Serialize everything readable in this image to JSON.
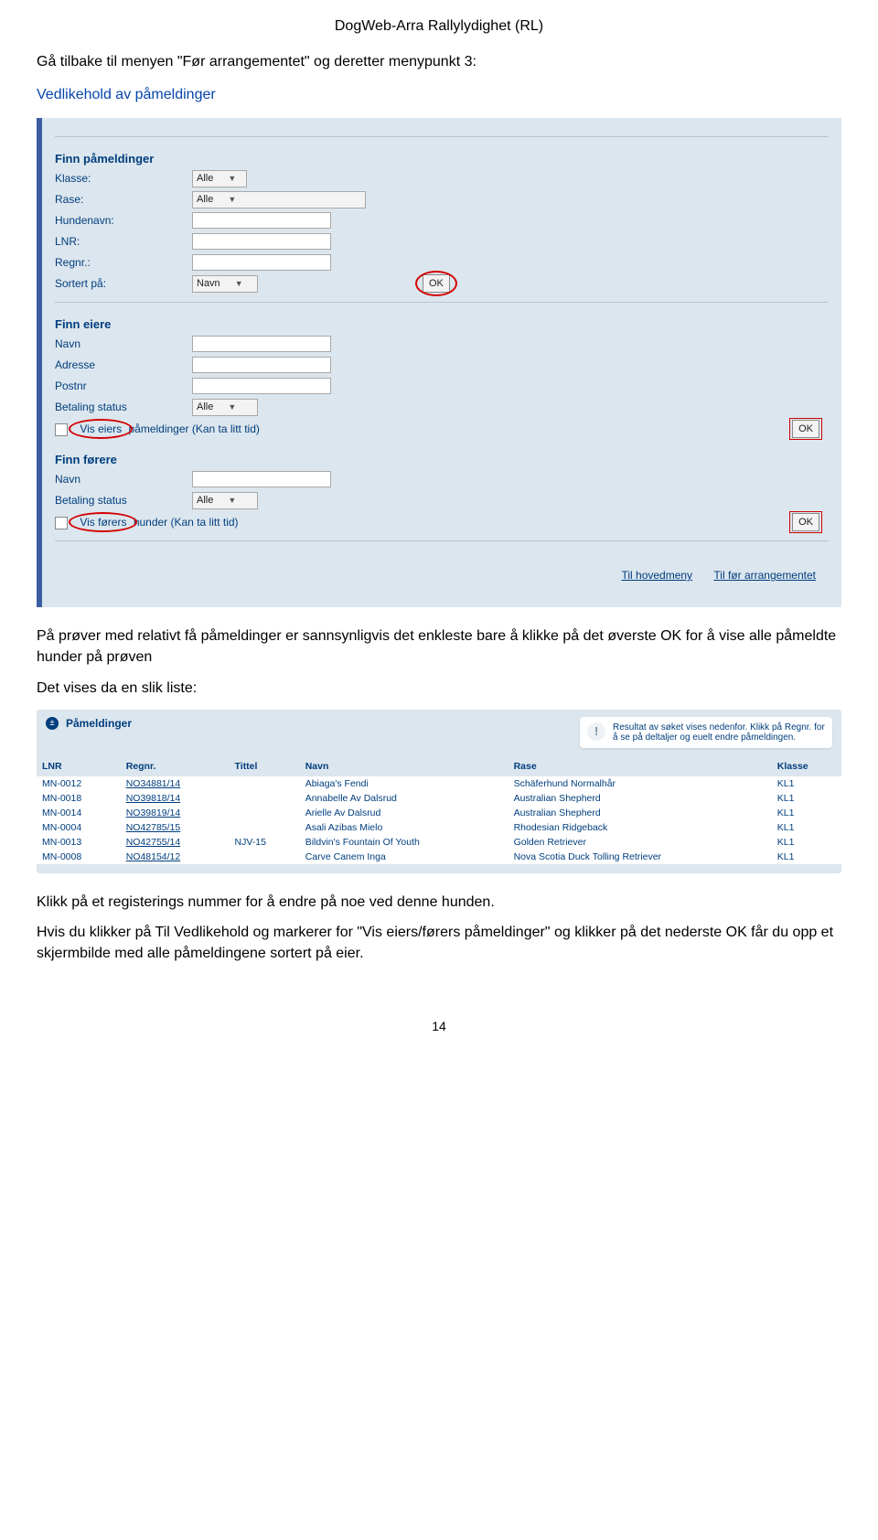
{
  "header": "DogWeb-Arra Rallylydighet (RL)",
  "intro1": "Gå tilbake til menyen \"Før arrangementet\" og deretter menypunkt 3:",
  "intro2": "Vedlikehold av påmeldinger",
  "ss1": {
    "finn_pameldinger": "Finn påmeldinger",
    "klasse": "Klasse:",
    "rase": "Rase:",
    "hundenavn": "Hundenavn:",
    "lnr": "LNR:",
    "regnr": "Regnr.:",
    "sortert": "Sortert på:",
    "alle": "Alle",
    "navn": "Navn",
    "ok": "OK",
    "finn_eiere": "Finn eiere",
    "e_navn": "Navn",
    "e_adresse": "Adresse",
    "e_postnr": "Postnr",
    "betaling": "Betaling status",
    "vis_eiers": "Vis eiers påmeldinger (Kan ta litt tid)",
    "finn_forere": "Finn førere",
    "vis_forers": "Vis førers hunder (Kan ta litt tid)",
    "hovedmeny": "Til hovedmeny",
    "for_arr": "Til før arrangementet"
  },
  "mid1": "På prøver med relativt få påmeldinger er sannsynligvis det enkleste bare å klikke på det øverste OK for å vise alle påmeldte hunder på prøven",
  "mid2": "Det vises da en slik liste:",
  "ss2": {
    "pameldinger": "Påmeldinger",
    "info": "Resultat av søket vises nedenfor. Klikk på Regnr. for å se på deltaljer og euelt endre påmeldingen.",
    "headers": {
      "lnr": "LNR",
      "regnr": "Regnr.",
      "tittel": "Tittel",
      "navn": "Navn",
      "rase": "Rase",
      "klasse": "Klasse"
    },
    "rows": [
      {
        "lnr": "MN-0012",
        "regnr": "NO34881/14",
        "tittel": "",
        "navn": "Abiaga's Fendi",
        "rase": "Schäferhund Normalhår",
        "klasse": "KL1"
      },
      {
        "lnr": "MN-0018",
        "regnr": "NO39818/14",
        "tittel": "",
        "navn": "Annabelle Av Dalsrud",
        "rase": "Australian Shepherd",
        "klasse": "KL1"
      },
      {
        "lnr": "MN-0014",
        "regnr": "NO39819/14",
        "tittel": "",
        "navn": "Arielle Av Dalsrud",
        "rase": "Australian Shepherd",
        "klasse": "KL1"
      },
      {
        "lnr": "MN-0004",
        "regnr": "NO42785/15",
        "tittel": "",
        "navn": "Asali Azibas Mielo",
        "rase": "Rhodesian Ridgeback",
        "klasse": "KL1"
      },
      {
        "lnr": "MN-0013",
        "regnr": "NO42755/14",
        "tittel": "NJV-15",
        "navn": "Bildvin's Fountain Of Youth",
        "rase": "Golden Retriever",
        "klasse": "KL1"
      },
      {
        "lnr": "MN-0008",
        "regnr": "NO48154/12",
        "tittel": "",
        "navn": "Carve Canem Inga",
        "rase": "Nova Scotia Duck Tolling Retriever",
        "klasse": "KL1"
      }
    ]
  },
  "para1": "Klikk på et registerings nummer for å endre på noe ved denne hunden.",
  "para2": "Hvis du klikker på Til Vedlikehold og markerer for \"Vis eiers/førers påmeldinger\" og klikker på det nederste OK får du opp et skjermbilde med alle påmeldingene sortert på eier.",
  "pagenum": "14"
}
